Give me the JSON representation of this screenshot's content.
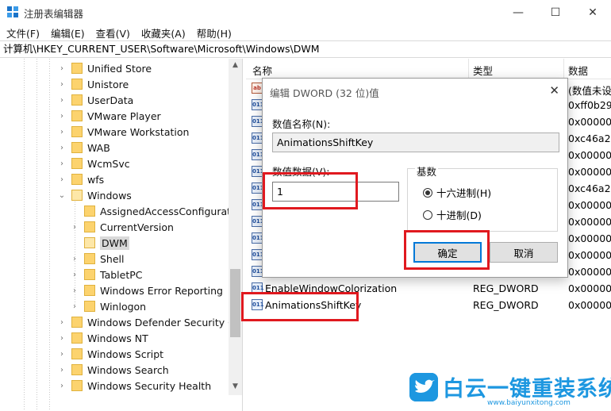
{
  "window": {
    "title": "注册表编辑器",
    "minimize": "—",
    "maximize": "☐",
    "close": "✕"
  },
  "menu": [
    "文件(F)",
    "编辑(E)",
    "查看(V)",
    "收藏夹(A)",
    "帮助(H)"
  ],
  "address": "计算机\\HKEY_CURRENT_USER\\Software\\Microsoft\\Windows\\DWM",
  "tree": [
    {
      "label": "Unified Store",
      "level": 1,
      "expanded": false
    },
    {
      "label": "Unistore",
      "level": 1,
      "expanded": false
    },
    {
      "label": "UserData",
      "level": 1,
      "expanded": false
    },
    {
      "label": "VMware Player",
      "level": 1,
      "expanded": false
    },
    {
      "label": "VMware Workstation",
      "level": 1,
      "expanded": false
    },
    {
      "label": "WAB",
      "level": 1,
      "expanded": false
    },
    {
      "label": "WcmSvc",
      "level": 1,
      "expanded": false
    },
    {
      "label": "wfs",
      "level": 1,
      "expanded": false
    },
    {
      "label": "Windows",
      "level": 1,
      "expanded": true
    },
    {
      "label": "AssignedAccessConfiguratio",
      "level": 2,
      "expanded": null
    },
    {
      "label": "CurrentVersion",
      "level": 2,
      "expanded": false
    },
    {
      "label": "DWM",
      "level": 2,
      "expanded": null,
      "selected": true
    },
    {
      "label": "Shell",
      "level": 2,
      "expanded": false
    },
    {
      "label": "TabletPC",
      "level": 2,
      "expanded": false
    },
    {
      "label": "Windows Error Reporting",
      "level": 2,
      "expanded": false
    },
    {
      "label": "Winlogon",
      "level": 2,
      "expanded": false
    },
    {
      "label": "Windows Defender Security Ce",
      "level": 1,
      "expanded": false
    },
    {
      "label": "Windows NT",
      "level": 1,
      "expanded": false
    },
    {
      "label": "Windows Script",
      "level": 1,
      "expanded": false
    },
    {
      "label": "Windows Search",
      "level": 1,
      "expanded": false
    },
    {
      "label": "Windows Security Health",
      "level": 1,
      "expanded": false
    }
  ],
  "list": {
    "headers": {
      "name": "名称",
      "type": "类型",
      "data": "数据"
    },
    "rows": [
      {
        "icon": "ab",
        "name": "",
        "type": "",
        "data": "(数值未设"
      },
      {
        "icon": "011",
        "name": "",
        "type": "",
        "data": "0xff0b29"
      },
      {
        "icon": "011",
        "name": "",
        "type": "",
        "data": "0x000000"
      },
      {
        "icon": "011",
        "name": "",
        "type": "",
        "data": "0xc46a29"
      },
      {
        "icon": "011",
        "name": "",
        "type": "",
        "data": "0x000000"
      },
      {
        "icon": "011",
        "name": "",
        "type": "",
        "data": "0x000000"
      },
      {
        "icon": "011",
        "name": "",
        "type": "",
        "data": "0xc46a29"
      },
      {
        "icon": "011",
        "name": "",
        "type": "",
        "data": "0x000000"
      },
      {
        "icon": "011",
        "name": "",
        "type": "",
        "data": "0x000000"
      },
      {
        "icon": "011",
        "name": "",
        "type": "",
        "data": "0x000000"
      },
      {
        "icon": "011",
        "name": "",
        "type": "",
        "data": "0x000000"
      },
      {
        "icon": "011",
        "name": "",
        "type": "",
        "data": "0x000000"
      },
      {
        "icon": "011",
        "name": "EnableWindowColorization",
        "type": "REG_DWORD",
        "data": "0x000000"
      },
      {
        "icon": "011",
        "name": "AnimationsShiftKey",
        "type": "REG_DWORD",
        "data": "0x000000"
      }
    ]
  },
  "dialog": {
    "title": "编辑 DWORD (32 位)值",
    "close": "✕",
    "name_label": "数值名称(N):",
    "name_value": "AnimationsShiftKey",
    "data_label": "数值数据(V):",
    "data_value": "1",
    "base_label": "基数",
    "hex_label": "十六进制(H)",
    "dec_label": "十进制(D)",
    "ok": "确定",
    "cancel": "取消"
  },
  "watermark": {
    "title": "白云一键重装系统",
    "url": "www.baiyunxitong.com"
  },
  "colors": {
    "highlight": "#e0191f",
    "brand": "#1d97e0"
  }
}
